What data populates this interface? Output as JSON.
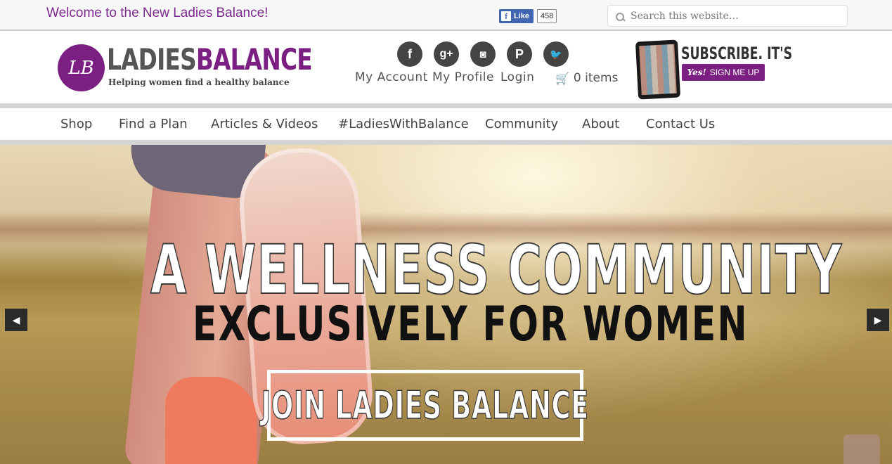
{
  "topbar": {
    "welcome": "Welcome to the New Ladies Balance!",
    "fb_like_label": "Like",
    "fb_like_count": "458",
    "search_placeholder": "Search this website…"
  },
  "header": {
    "logo_monogram": "LB",
    "logo_ladies": "LADIES",
    "logo_balance": "BALANCE",
    "tagline": "Helping women find a healthy balance",
    "social_icons": [
      "facebook-icon",
      "google-plus-icon",
      "instagram-icon",
      "pinterest-icon",
      "twitter-icon"
    ],
    "social_glyphs": [
      "f",
      "g+",
      "◙",
      "P",
      "🐦"
    ],
    "account_links": [
      "My Account",
      "My Profile",
      "Login"
    ],
    "cart_label": "0 items",
    "subscribe_title": "SUBSCRIBE. IT'S FREE!",
    "signup_yes": "Yes!",
    "signup_label": "SIGN ME UP"
  },
  "nav": {
    "items": [
      "Shop",
      "Find a Plan",
      "Articles & Videos",
      "#LadiesWithBalance",
      "Community",
      "About",
      "Contact Us"
    ]
  },
  "hero": {
    "line1": "A WELLNESS COMMUNITY",
    "line2": "EXCLUSIVELY FOR WOMEN",
    "cta": "JOIN LADIES BALANCE",
    "prev_arrow": "◀",
    "next_arrow": "▶"
  },
  "colors": {
    "brand_purple": "#7b1f83",
    "social_bg": "#444444",
    "welcome_text": "#7b2a8e"
  }
}
